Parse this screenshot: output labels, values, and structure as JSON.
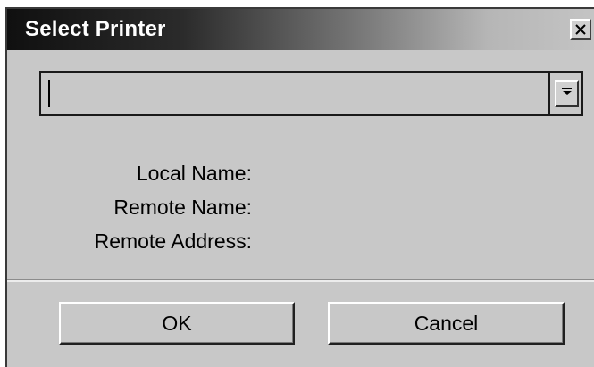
{
  "window": {
    "title": "Select Printer",
    "close_icon": "close-icon"
  },
  "printer_select": {
    "value": "",
    "dropdown_icon": "chevron-down-icon"
  },
  "info_labels": {
    "local_name": "Local Name:",
    "remote_name": "Remote Name:",
    "remote_address": "Remote Address:"
  },
  "buttons": {
    "ok": "OK",
    "cancel": "Cancel"
  },
  "colors": {
    "dialog_background": "#c8c8c8",
    "titlebar_start": "#101010",
    "titlebar_end": "#c4c4c4",
    "title_text": "#ffffff"
  }
}
